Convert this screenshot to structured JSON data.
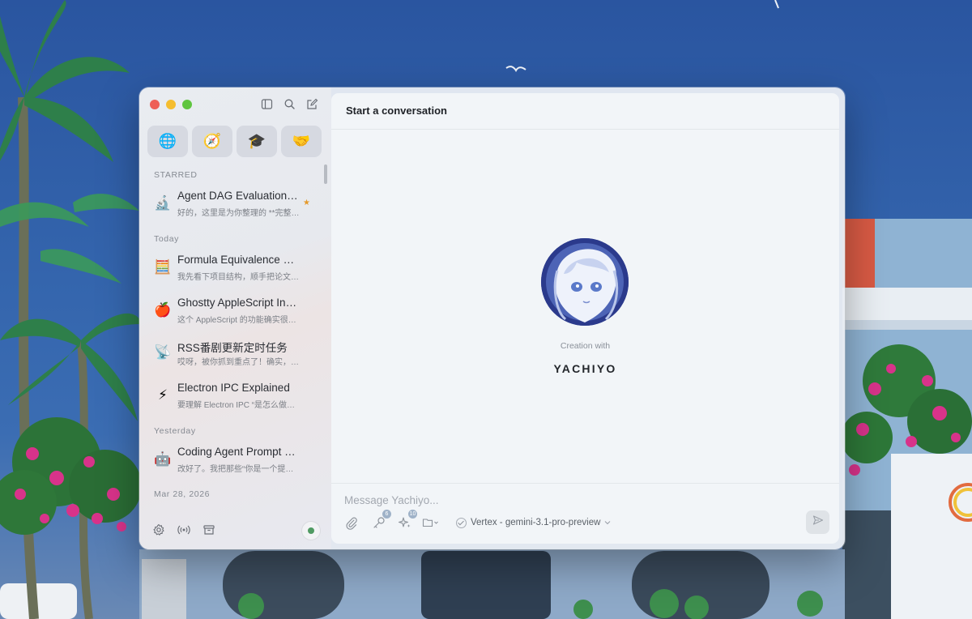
{
  "sidebar": {
    "agents": [
      {
        "name": "yachiyo-agent",
        "glyph": "🌐"
      },
      {
        "name": "compass-agent",
        "glyph": "🧭"
      },
      {
        "name": "graduation-agent",
        "glyph": "🎓"
      },
      {
        "name": "handshake-agent",
        "glyph": "🤝"
      }
    ],
    "starred_label": "STARRED",
    "today_label": "Today",
    "yesterday_label": "Yesterday",
    "older_label": "Mar 28, 2026",
    "conversations": [
      {
        "icon": "🔬",
        "title": "Agent DAG Evaluation …",
        "preview": "好的，这里是为你整理的 **完整…",
        "starred": true
      },
      {
        "icon": "🧮",
        "title": "Formula Equivalence C…",
        "preview": "我先看下项目结构，顺手把论文…",
        "starred": false
      },
      {
        "icon": "🍎",
        "title": "Ghostty AppleScript In…",
        "preview": "这个 AppleScript 的功能确实很…",
        "starred": false
      },
      {
        "icon": "📡",
        "title": "RSS番剧更新定时任务",
        "preview": "哎呀，被你抓到重点了！确实，…",
        "starred": false
      },
      {
        "icon": "⚡",
        "title": "Electron IPC Explained",
        "preview": "要理解 Electron IPC “是怎么做…",
        "starred": false
      },
      {
        "icon": "🤖",
        "title": "Coding Agent Prompt …",
        "preview": "改好了。我把那些“你是一个提…",
        "starred": false
      }
    ],
    "star_glyph": "★"
  },
  "main": {
    "title": "Start a conversation",
    "creation_with": "Creation with",
    "app_name": "YACHIYO",
    "composer": {
      "placeholder": "Message Yachiyo...",
      "skills_badge": "6",
      "tools_badge": "10",
      "model": "Vertex - gemini-3.1-pro-preview"
    }
  },
  "colors": {
    "accent_star": "#e59a2b",
    "status_online": "#4f9a62",
    "wallpaper_sky": "#2f5fa8"
  }
}
